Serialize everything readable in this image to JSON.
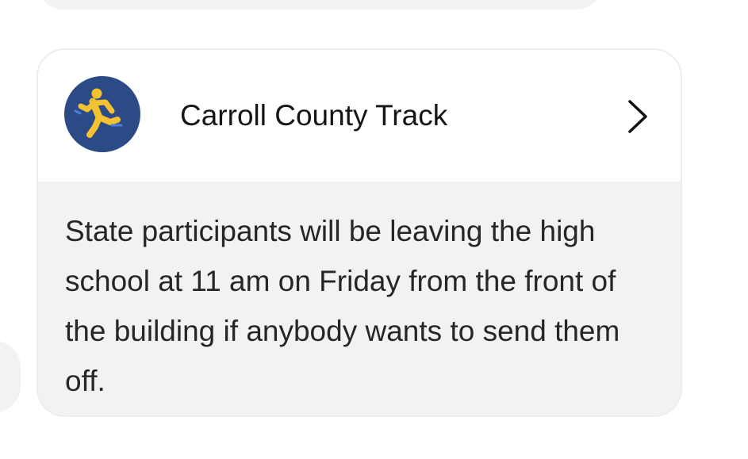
{
  "announcement": {
    "group_name": "Carroll County Track",
    "message": "State participants will be leaving the high school at 11 am on Friday from the front of the building if anybody wants to send them off.",
    "avatar_icon": "runner-icon",
    "chevron_icon": "chevron-right-icon"
  },
  "colors": {
    "avatar_bg": "#2c4a86",
    "runner": "#f2c230",
    "body_bg": "#f1f2f4"
  }
}
